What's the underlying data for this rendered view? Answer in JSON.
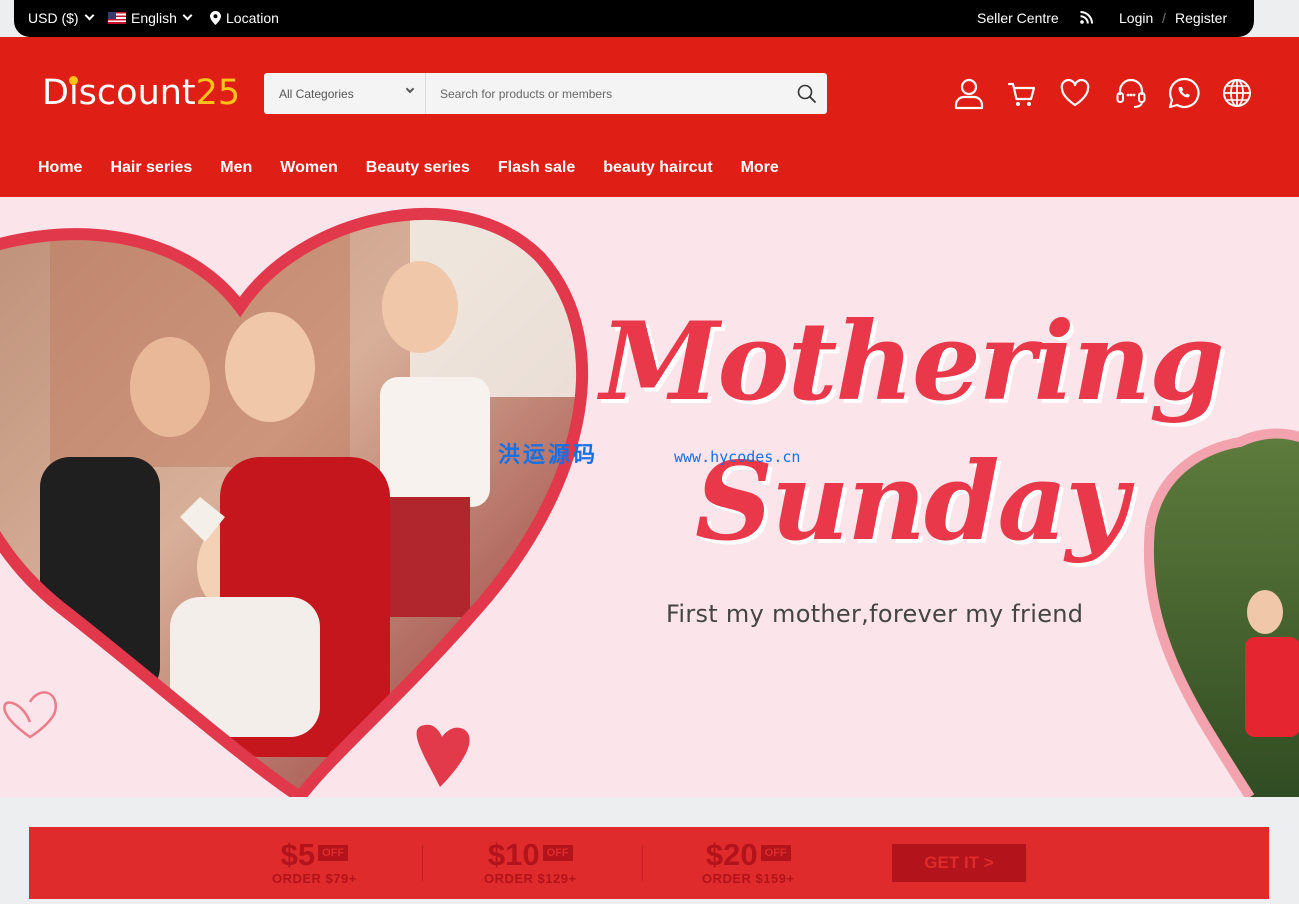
{
  "topbar": {
    "currency": "USD ($)",
    "language": "English",
    "location": "Location",
    "seller_centre": "Seller Centre",
    "login": "Login",
    "divider": "/",
    "register": "Register"
  },
  "header": {
    "logo_text": "Discount",
    "logo_digits": "25",
    "category_select": "All Categories",
    "search_placeholder": "Search for products or members",
    "icons": [
      "user-icon",
      "cart-icon",
      "heart-icon",
      "support-headset-icon",
      "whatsapp-icon",
      "globe-icon"
    ]
  },
  "nav": {
    "items": [
      "Home",
      "Hair series",
      "Men",
      "Women",
      "Beauty series",
      "Flash sale",
      "beauty haircut",
      "More"
    ]
  },
  "banner": {
    "headline_line1": "Mothering",
    "headline_line2": "Sunday",
    "tagline": "First my mother,forever my friend",
    "watermark_cn": "洪运源码",
    "watermark_url": "www.hycodes.cn"
  },
  "coupons": {
    "items": [
      {
        "amount": "$5",
        "off": "OFF",
        "order": "ORDER $79+"
      },
      {
        "amount": "$10",
        "off": "OFF",
        "order": "ORDER $129+"
      },
      {
        "amount": "$20",
        "off": "OFF",
        "order": "ORDER $159+"
      }
    ],
    "cta": "GET IT >"
  },
  "colors": {
    "brand_red": "#df1e15",
    "logo_yellow": "#ffc21a",
    "banner_pink": "#fbe4ea",
    "headline_red": "#e8384a",
    "coupon_red": "#df2b2b",
    "coupon_dark": "#b3131a"
  }
}
